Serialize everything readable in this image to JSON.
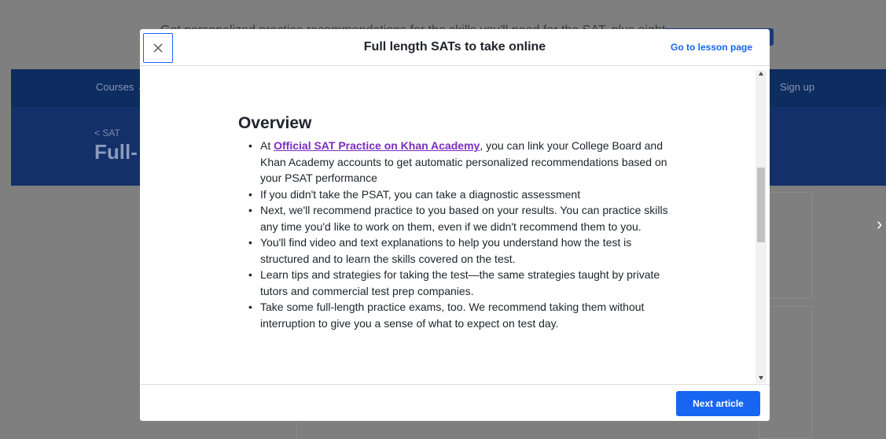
{
  "background": {
    "banner_text": "Get personalized practice recommendations for the skills you'll need for the SAT, plus eight",
    "nav": {
      "courses_label": "Courses ⌄",
      "signup_label": "Sign up"
    },
    "header": {
      "back_label": "< SAT",
      "title": "Full-"
    }
  },
  "modal": {
    "title": "Full length SATs to take online",
    "lesson_link": "Go to lesson page",
    "article": {
      "heading": "Overview",
      "items": [
        {
          "pre": "At ",
          "link": "Official SAT Practice on Khan Academy",
          "post": ", you can link your College Board and Khan Academy accounts to get automatic personalized recommendations based on your PSAT performance"
        },
        {
          "text": "If you didn't take the PSAT, you can take a diagnostic assessment"
        },
        {
          "text": "Next, we'll recommend practice to you based on your results. You can practice skills any time you'd like to work on them, even if we didn't recommend them to you."
        },
        {
          "text": "You'll find video and text explanations to help you understand how the test is structured and to learn the skills covered on the test."
        },
        {
          "text": "Learn tips and strategies for taking the test—the same strategies taught by private tutors and commercial test prep companies."
        },
        {
          "text": "Take some full-length practice exams, too. We recommend taking them without interruption to give you a sense of what to expect on test day."
        }
      ]
    },
    "next_label": "Next article"
  },
  "icons": {
    "close": "close-icon",
    "next_arrow": "chevron-right-icon"
  },
  "colors": {
    "accent": "#1865f2",
    "link": "#7a2dbf",
    "nav": "#0d2c5f"
  }
}
